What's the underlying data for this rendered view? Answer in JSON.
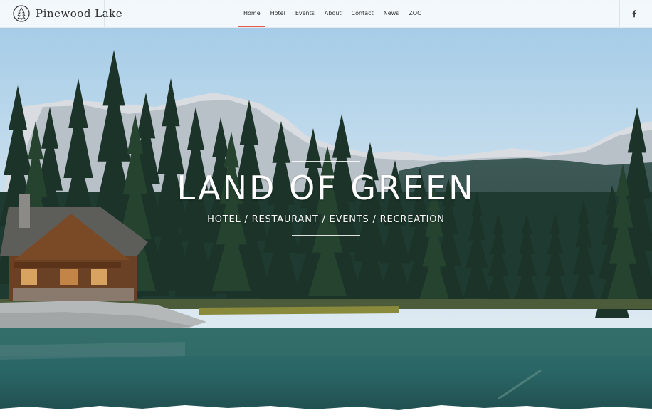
{
  "brand": {
    "name": "Pinewood Lake",
    "logo_icon": "pine-tree-icon"
  },
  "nav": {
    "items": [
      {
        "label": "Home",
        "active": true
      },
      {
        "label": "Hotel"
      },
      {
        "label": "Events"
      },
      {
        "label": "About"
      },
      {
        "label": "Contact"
      },
      {
        "label": "News"
      },
      {
        "label": "ZOO"
      }
    ],
    "active_color": "#e5584a"
  },
  "social": {
    "icon": "facebook-icon"
  },
  "hero": {
    "title": "LAND OF GREEN",
    "subtitle": "HOTEL / RESTAURANT / EVENTS / RECREATION"
  }
}
